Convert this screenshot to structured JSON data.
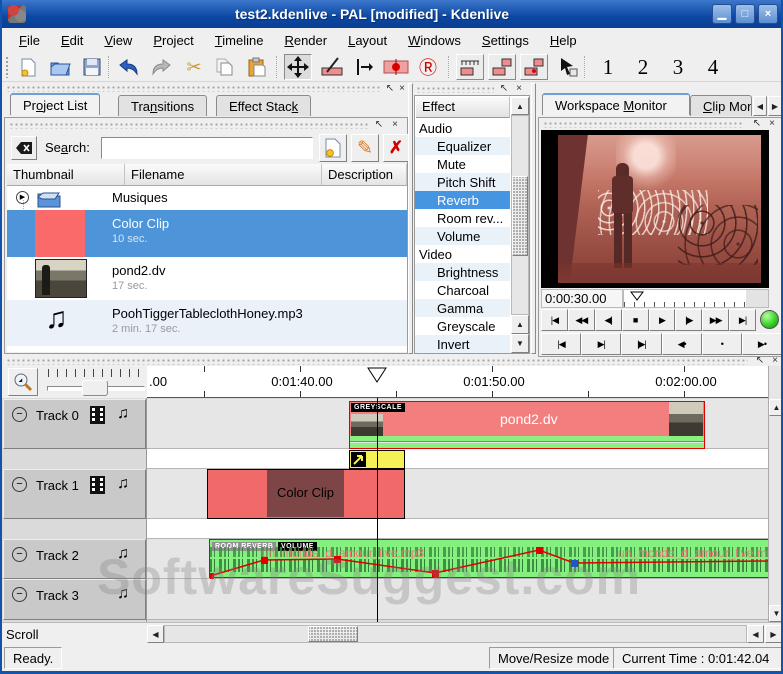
{
  "window": {
    "title": "test2.kdenlive - PAL [modified] - Kdenlive"
  },
  "titlebar": {
    "minimize": "▁",
    "maximize": "□",
    "close": "×"
  },
  "menu": {
    "items": [
      {
        "pre": "",
        "accel": "F",
        "post": "ile"
      },
      {
        "pre": "",
        "accel": "E",
        "post": "dit"
      },
      {
        "pre": "",
        "accel": "V",
        "post": "iew"
      },
      {
        "pre": "",
        "accel": "P",
        "post": "roject"
      },
      {
        "pre": "",
        "accel": "T",
        "post": "imeline"
      },
      {
        "pre": "",
        "accel": "R",
        "post": "ender"
      },
      {
        "pre": "",
        "accel": "L",
        "post": "ayout"
      },
      {
        "pre": "",
        "accel": "W",
        "post": "indows"
      },
      {
        "pre": "",
        "accel": "S",
        "post": "ettings"
      },
      {
        "pre": "",
        "accel": "H",
        "post": "elp"
      }
    ]
  },
  "toolbar": {
    "numbers": [
      "1",
      "2",
      "3",
      "4"
    ]
  },
  "project": {
    "tabs": [
      {
        "pre": "Pr",
        "accel": "o",
        "post": "ject List"
      },
      {
        "pre": "Tra",
        "accel": "n",
        "post": "sitions"
      },
      {
        "pre": "Effect Stac",
        "accel": "k",
        "post": ""
      }
    ],
    "search": {
      "pre": "Se",
      "accel": "a",
      "post": "rch:",
      "value": ""
    },
    "columns": [
      "Thumbnail",
      "Filename",
      "Description"
    ],
    "items": [
      {
        "name": "Musiques",
        "duration": ""
      },
      {
        "name": "Color Clip",
        "duration": "10 sec."
      },
      {
        "name": "pond2.dv",
        "duration": "17 sec."
      },
      {
        "name": "PoohTiggerTableclothHoney.mp3",
        "duration": "2 min. 17 sec."
      }
    ]
  },
  "effects": {
    "header": "Effect",
    "items": [
      {
        "label": "Audio"
      },
      {
        "label": "Equalizer"
      },
      {
        "label": "Mute"
      },
      {
        "label": "Pitch Shift"
      },
      {
        "label": "Reverb"
      },
      {
        "label": "Room rev..."
      },
      {
        "label": "Volume"
      },
      {
        "label": "Video"
      },
      {
        "label": "Brightness"
      },
      {
        "label": "Charcoal"
      },
      {
        "label": "Gamma"
      },
      {
        "label": "Greyscale"
      },
      {
        "label": "Invert"
      }
    ],
    "selected": "Reverb"
  },
  "monitor": {
    "tabs": [
      {
        "pre": "Workspace ",
        "accel": "M",
        "post": "onitor"
      },
      {
        "pre": "",
        "accel": "C",
        "post": "lip Mon"
      }
    ],
    "timecode": "0:00:30.00",
    "transport_row1": [
      "|◀",
      "◀◀",
      "◀|",
      "■",
      "▶",
      "|▶",
      "▶▶",
      "▶|"
    ],
    "transport_row2": [
      "|◀",
      "▶|",
      "|▶|",
      "◀•",
      "•",
      "▶•"
    ]
  },
  "timeline": {
    "ruler_labels": [
      ".00",
      "0:01:40.00",
      "0:01:50.00",
      "0:02:00.00"
    ],
    "tracks": [
      {
        "name": "Track 0"
      },
      {
        "name": "Track 1"
      },
      {
        "name": "Track 2"
      },
      {
        "name": "Track 3"
      }
    ],
    "clips": {
      "pond2": {
        "label": "pond2.dv",
        "badge": "GREYSCALE"
      },
      "color": {
        "label": "Color Clip"
      },
      "audio": {
        "badge1": "ROOM REVERB",
        "badge2": "VOLUME",
        "filename": "un_monde_d_amour_live.mp3"
      }
    },
    "scroll_label": "Scroll"
  },
  "status": {
    "ready": "Ready.",
    "mode": "Move/Resize mode",
    "time": "Current Time : 0:01:42.04"
  },
  "watermark": "SoftwareSuggest.com",
  "icons": {
    "undock": "↖",
    "close": "×",
    "up": "▲",
    "down": "▼",
    "left": "◀",
    "right": "▶",
    "minus": "−",
    "note": "♫",
    "expander": "▶",
    "cut": "✂",
    "record_r": "Ⓡ",
    "star": "★",
    "pencil": "✎",
    "delete": "✗",
    "clear": "×"
  },
  "colors": {
    "titlebar": "#0d4fa6",
    "selection": "#4d94d8",
    "clip_red": "#f06a6a",
    "clip_dark_red": "#7d4545",
    "clip_green": "#84f07d",
    "transition_yellow": "#f5f056",
    "envelope": "#e00000"
  }
}
